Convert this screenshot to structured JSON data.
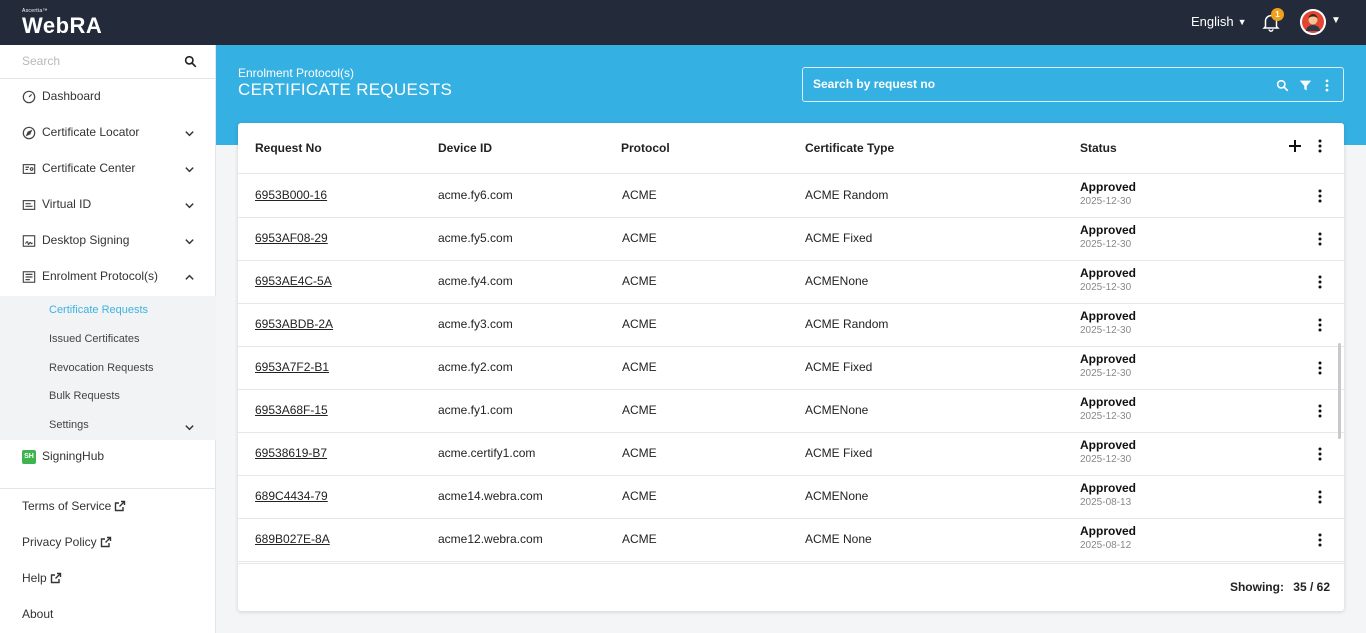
{
  "app": {
    "brand_small": "Ascertia™",
    "brand_name": "WebRA",
    "language": "English",
    "notification_count": "1"
  },
  "sidebar": {
    "search_placeholder": "Search",
    "items": [
      {
        "label": "Dashboard",
        "icon": "dashboard-icon"
      },
      {
        "label": "Certificate Locator",
        "icon": "compass-icon"
      },
      {
        "label": "Certificate Center",
        "icon": "certificate-icon"
      },
      {
        "label": "Virtual ID",
        "icon": "id-card-icon"
      },
      {
        "label": "Desktop Signing",
        "icon": "desktop-signing-icon"
      },
      {
        "label": "Enrolment Protocol(s)",
        "icon": "enrolment-icon"
      }
    ],
    "submenu": [
      {
        "label": "Certificate Requests",
        "active": true
      },
      {
        "label": "Issued Certificates"
      },
      {
        "label": "Revocation Requests"
      },
      {
        "label": "Bulk Requests"
      },
      {
        "label": "Settings"
      }
    ],
    "signinghub": {
      "label": "SigningHub",
      "icon_text": "SH"
    },
    "footer": [
      {
        "label": "Terms of Service"
      },
      {
        "label": "Privacy Policy"
      },
      {
        "label": "Help"
      },
      {
        "label": "About"
      }
    ]
  },
  "header": {
    "breadcrumb": "Enrolment Protocol(s)",
    "title": "CERTIFICATE REQUESTS",
    "search_placeholder": "Search by request no"
  },
  "table": {
    "columns": [
      "Request No",
      "Device ID",
      "Protocol",
      "Certificate Type",
      "Status"
    ],
    "rows": [
      {
        "request_no": "6953B000-16",
        "device_id": "acme.fy6.com",
        "protocol": "ACME",
        "cert_type": "ACME Random",
        "status": "Approved",
        "date": "2025-12-30"
      },
      {
        "request_no": "6953AF08-29",
        "device_id": "acme.fy5.com",
        "protocol": "ACME",
        "cert_type": "ACME Fixed",
        "status": "Approved",
        "date": "2025-12-30"
      },
      {
        "request_no": "6953AE4C-5A",
        "device_id": "acme.fy4.com",
        "protocol": "ACME",
        "cert_type": "ACMENone",
        "status": "Approved",
        "date": "2025-12-30"
      },
      {
        "request_no": "6953ABDB-2A",
        "device_id": "acme.fy3.com",
        "protocol": "ACME",
        "cert_type": "ACME Random",
        "status": "Approved",
        "date": "2025-12-30"
      },
      {
        "request_no": "6953A7F2-B1",
        "device_id": "acme.fy2.com",
        "protocol": "ACME",
        "cert_type": "ACME Fixed",
        "status": "Approved",
        "date": "2025-12-30"
      },
      {
        "request_no": "6953A68F-15",
        "device_id": "acme.fy1.com",
        "protocol": "ACME",
        "cert_type": "ACMENone",
        "status": "Approved",
        "date": "2025-12-30"
      },
      {
        "request_no": "69538619-B7",
        "device_id": "acme.certify1.com",
        "protocol": "ACME",
        "cert_type": "ACME Fixed",
        "status": "Approved",
        "date": "2025-12-30"
      },
      {
        "request_no": "689C4434-79",
        "device_id": "acme14.webra.com",
        "protocol": "ACME",
        "cert_type": "ACMENone",
        "status": "Approved",
        "date": "2025-08-13"
      },
      {
        "request_no": "689B027E-8A",
        "device_id": "acme12.webra.com",
        "protocol": "ACME",
        "cert_type": "ACME None",
        "status": "Approved",
        "date": "2025-08-12"
      }
    ],
    "showing_label": "Showing:",
    "showing_value": "35 / 62"
  },
  "colors": {
    "topbar": "#232b3a",
    "accent": "#35b0e2",
    "badge": "#f0a019"
  }
}
